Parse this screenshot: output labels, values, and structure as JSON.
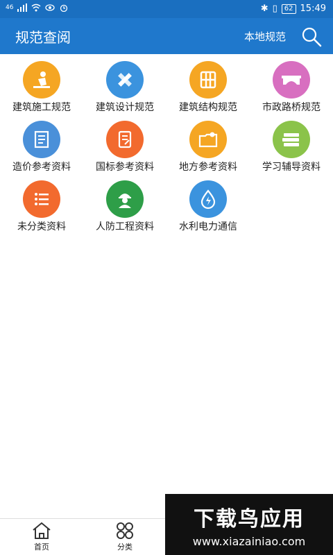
{
  "status": {
    "left_text": "46",
    "battery": "62",
    "time": "15:49"
  },
  "appbar": {
    "title": "规范查阅",
    "local_button": "本地规范"
  },
  "categories": [
    {
      "label": "建筑施工规范",
      "color": "#f5a623",
      "icon": "worker-icon"
    },
    {
      "label": "建筑设计规范",
      "color": "#3b93de",
      "icon": "ruler-pencil-icon"
    },
    {
      "label": "建筑结构规范",
      "color": "#f5a623",
      "icon": "building-block-icon"
    },
    {
      "label": "市政路桥规范",
      "color": "#d86fc0",
      "icon": "bridge-icon"
    },
    {
      "label": "造价参考资料",
      "color": "#4a90d9",
      "icon": "document-icon"
    },
    {
      "label": "国标参考资料",
      "color": "#f26a2e",
      "icon": "note-icon"
    },
    {
      "label": "地方参考资料",
      "color": "#f5a623",
      "icon": "map-folder-icon"
    },
    {
      "label": "学习辅导资料",
      "color": "#8bc34a",
      "icon": "books-icon"
    },
    {
      "label": "未分类资料",
      "color": "#f26a2e",
      "icon": "list-icon"
    },
    {
      "label": "人防工程资料",
      "color": "#2e9e48",
      "icon": "helmet-person-icon"
    },
    {
      "label": "水利电力通信",
      "color": "#3b93de",
      "icon": "water-power-icon"
    }
  ],
  "tabs": [
    {
      "label": "首页",
      "icon": "home-icon"
    },
    {
      "label": "分类",
      "icon": "grid-icon"
    }
  ],
  "watermark": {
    "big": "下载鸟应用",
    "url": "www.xiazainiao.com"
  }
}
